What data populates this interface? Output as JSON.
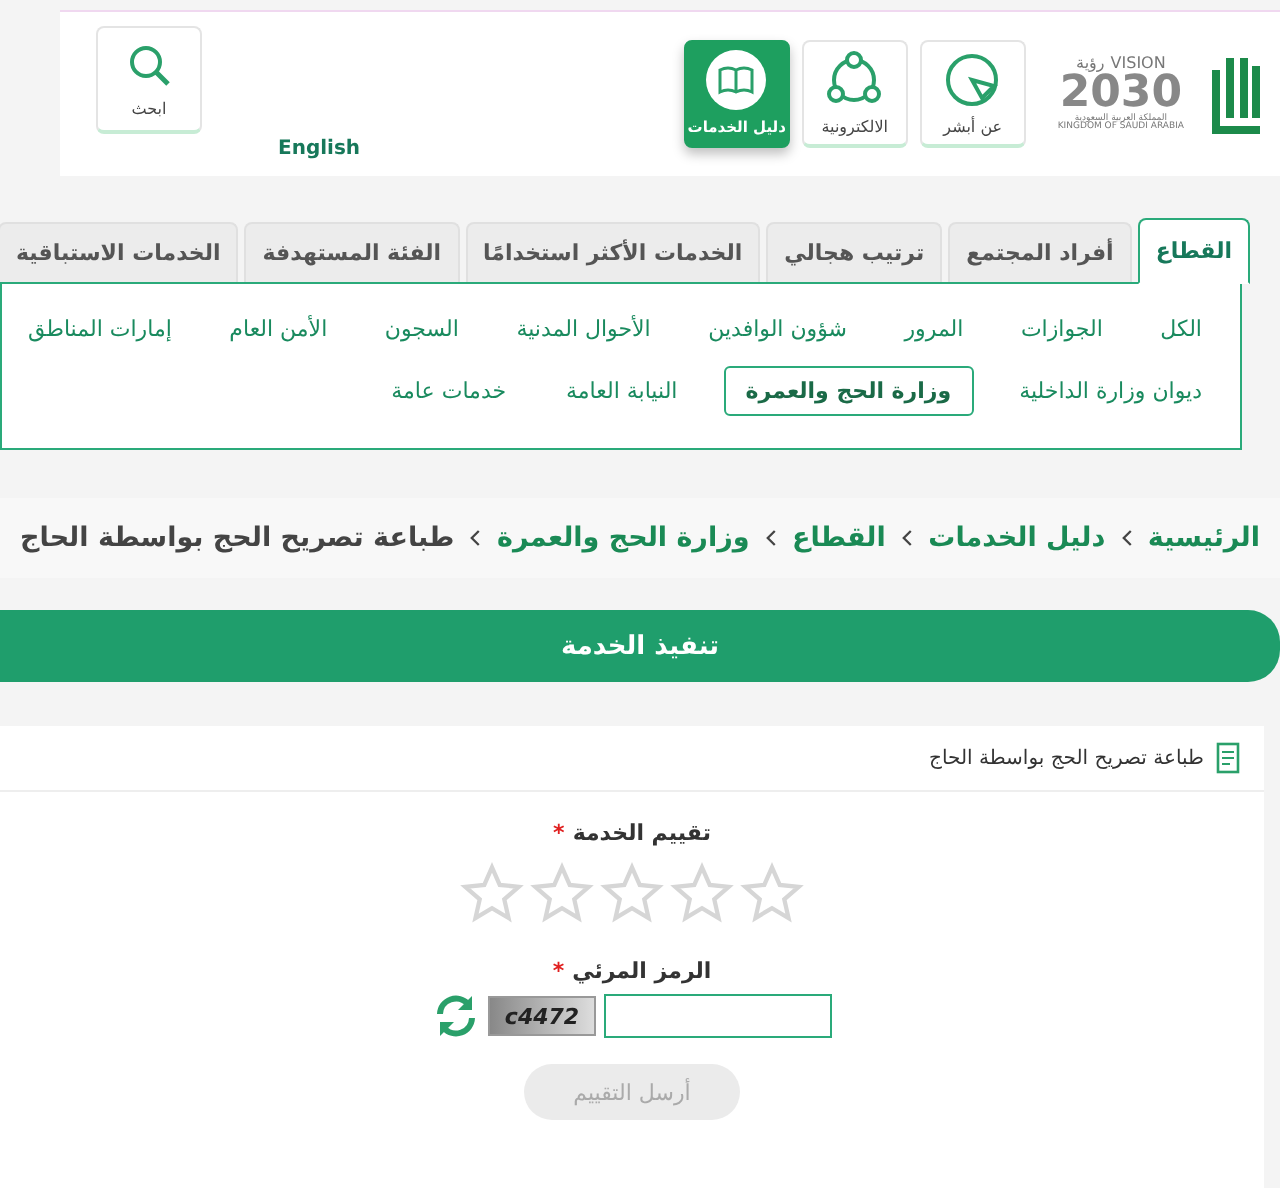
{
  "header": {
    "vision": {
      "word": "VISION",
      "arabic": "رؤية",
      "year": "2030",
      "country_ar": "المملكة العربية السعودية",
      "country_en": "KINGDOM OF SAUDI ARABIA"
    },
    "nav_buttons": [
      {
        "label": "عن أبشر",
        "kind": "play",
        "selected": false
      },
      {
        "label": "الالكترونية",
        "kind": "network",
        "selected": false
      },
      {
        "label": "دليل الخدمات",
        "kind": "book",
        "selected": true
      }
    ],
    "language_link": "English",
    "search_button": "ابحث"
  },
  "tabs": [
    {
      "label": "القطاع",
      "selected": true
    },
    {
      "label": "أفراد المجتمع",
      "selected": false
    },
    {
      "label": "ترتيب هجالي",
      "selected": false
    },
    {
      "label": "الخدمات الأكثر استخدامًا",
      "selected": false
    },
    {
      "label": "الفئة المستهدفة",
      "selected": false
    },
    {
      "label": "الخدمات الاستباقية",
      "selected": false
    }
  ],
  "sector_rows": [
    [
      {
        "label": "الكل",
        "selected": false
      },
      {
        "label": "الجوازات",
        "selected": false
      },
      {
        "label": "المرور",
        "selected": false
      },
      {
        "label": "شؤون الوافدين",
        "selected": false
      },
      {
        "label": "الأحوال المدنية",
        "selected": false
      },
      {
        "label": "السجون",
        "selected": false
      },
      {
        "label": "الأمن العام",
        "selected": false
      },
      {
        "label": "إمارات المناطق",
        "selected": false
      }
    ],
    [
      {
        "label": "ديوان وزارة الداخلية",
        "selected": false
      },
      {
        "label": "وزارة الحج والعمرة",
        "selected": true
      },
      {
        "label": "النيابة العامة",
        "selected": false
      },
      {
        "label": "خدمات عامة",
        "selected": false
      }
    ]
  ],
  "breadcrumb": [
    {
      "label": "الرئيسية",
      "current": false
    },
    {
      "label": "دليل الخدمات",
      "current": false
    },
    {
      "label": "القطاع",
      "current": false
    },
    {
      "label": "وزارة الحج والعمرة",
      "current": false
    },
    {
      "label": "طباعة تصريح الحج بواسطة الحاج",
      "current": true
    }
  ],
  "execute_button": "تنفيذ الخدمة",
  "service_title": "طباعة تصريح الحج بواسطة الحاج",
  "rating": {
    "label": "تقييم الخدمة",
    "required_mark": "*",
    "stars": 0
  },
  "captcha": {
    "label": "الرمز المرئي",
    "required_mark": "*",
    "code": "c4472"
  },
  "submit": {
    "label": "أرسل التقييم",
    "disabled": true
  }
}
